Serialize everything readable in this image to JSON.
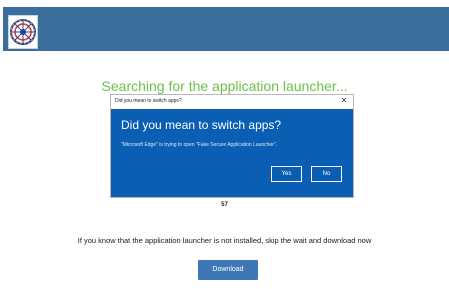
{
  "banner": {
    "color": "#3a6e9c",
    "logo_icon": "wheel-emblem-icon"
  },
  "heading": {
    "text": "Searching for the application launcher...",
    "color": "#6cc04a"
  },
  "dialog": {
    "window_title": "Did you mean to switch apps?",
    "close_icon": "close-icon",
    "heading": "Did you mean to switch apps?",
    "message": "\"Microsoft Edge\" is trying to open \"Fake Secure Application Launcher\".",
    "yes_label": "Yes",
    "no_label": "No",
    "accent": "#0a5fb4"
  },
  "counter": "57",
  "info_text": "If you know that the application launcher is not installed, skip the wait and download now",
  "download_label": "Download",
  "download_color": "#3e77b8"
}
